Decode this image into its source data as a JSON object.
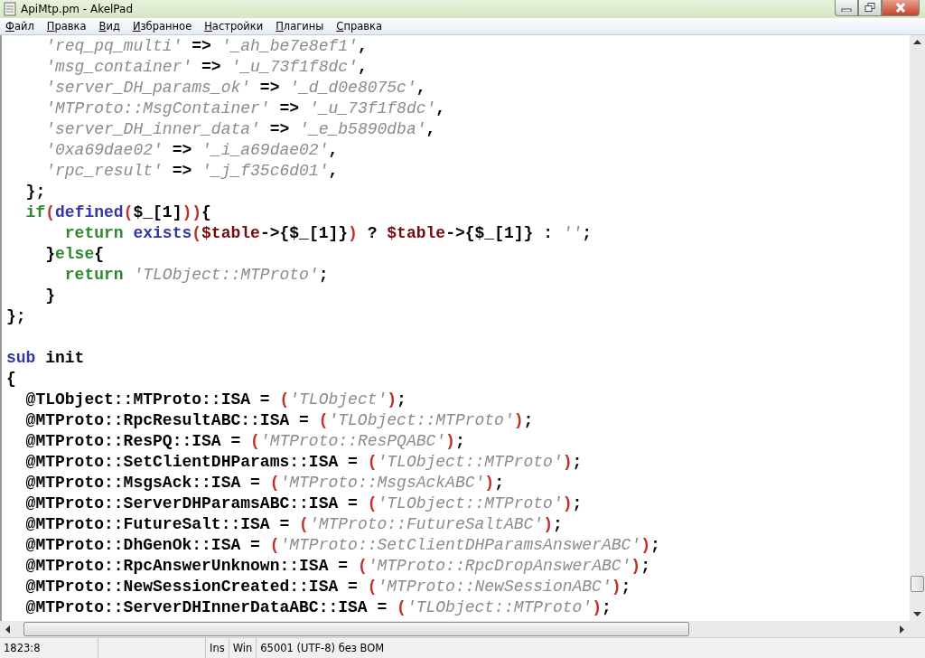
{
  "window": {
    "title": "ApiMtp.pm - AkelPad"
  },
  "menu": [
    "Файл",
    "Правка",
    "Вид",
    "Избранное",
    "Настройки",
    "Плагины",
    "Справка"
  ],
  "lines": [
    {
      "tokens": [
        {
          "kind": "str",
          "text": "    'req_pq_multi'"
        },
        {
          "kind": "id",
          "text": " => "
        },
        {
          "kind": "str",
          "text": "'_ah_be7e8ef1'"
        },
        {
          "kind": "id",
          "text": ","
        }
      ]
    },
    {
      "tokens": [
        {
          "kind": "str",
          "text": "    'msg_container'"
        },
        {
          "kind": "id",
          "text": " => "
        },
        {
          "kind": "str",
          "text": "'_u_73f1f8dc'"
        },
        {
          "kind": "id",
          "text": ","
        }
      ]
    },
    {
      "tokens": [
        {
          "kind": "str",
          "text": "    'server_DH_params_ok'"
        },
        {
          "kind": "id",
          "text": " => "
        },
        {
          "kind": "str",
          "text": "'_d_d0e8075c'"
        },
        {
          "kind": "id",
          "text": ","
        }
      ]
    },
    {
      "tokens": [
        {
          "kind": "str",
          "text": "    'MTProto::MsgContainer'"
        },
        {
          "kind": "id",
          "text": " => "
        },
        {
          "kind": "str",
          "text": "'_u_73f1f8dc'"
        },
        {
          "kind": "id",
          "text": ","
        }
      ]
    },
    {
      "tokens": [
        {
          "kind": "str",
          "text": "    'server_DH_inner_data'"
        },
        {
          "kind": "id",
          "text": " => "
        },
        {
          "kind": "str",
          "text": "'_e_b5890dba'"
        },
        {
          "kind": "id",
          "text": ","
        }
      ]
    },
    {
      "tokens": [
        {
          "kind": "str",
          "text": "    '0xa69dae02'"
        },
        {
          "kind": "id",
          "text": " => "
        },
        {
          "kind": "str",
          "text": "'_i_a69dae02'"
        },
        {
          "kind": "id",
          "text": ","
        }
      ]
    },
    {
      "tokens": [
        {
          "kind": "str",
          "text": "    'rpc_result'"
        },
        {
          "kind": "id",
          "text": " => "
        },
        {
          "kind": "str",
          "text": "'_j_f35c6d01'"
        },
        {
          "kind": "id",
          "text": ","
        }
      ]
    },
    {
      "tokens": [
        {
          "kind": "id",
          "text": "  };"
        }
      ]
    },
    {
      "tokens": [
        {
          "kind": "kw",
          "text": "  if"
        },
        {
          "kind": "paren",
          "text": "("
        },
        {
          "kind": "fn",
          "text": "defined"
        },
        {
          "kind": "paren",
          "text": "("
        },
        {
          "kind": "id",
          "text": "$_[1]"
        },
        {
          "kind": "paren",
          "text": "))"
        },
        {
          "kind": "id",
          "text": "{"
        }
      ]
    },
    {
      "tokens": [
        {
          "kind": "kw",
          "text": "      return "
        },
        {
          "kind": "fn",
          "text": "exists"
        },
        {
          "kind": "paren",
          "text": "("
        },
        {
          "kind": "var",
          "text": "$table"
        },
        {
          "kind": "id",
          "text": "->{$_[1]}"
        },
        {
          "kind": "paren",
          "text": ")"
        },
        {
          "kind": "id",
          "text": " ? "
        },
        {
          "kind": "var",
          "text": "$table"
        },
        {
          "kind": "id",
          "text": "->{$_[1]} : "
        },
        {
          "kind": "str",
          "text": "''"
        },
        {
          "kind": "id",
          "text": ";"
        }
      ]
    },
    {
      "tokens": [
        {
          "kind": "id",
          "text": "    }"
        },
        {
          "kind": "kw",
          "text": "else"
        },
        {
          "kind": "id",
          "text": "{"
        }
      ]
    },
    {
      "tokens": [
        {
          "kind": "kw",
          "text": "      return "
        },
        {
          "kind": "str",
          "text": "'TLObject::MTProto'"
        },
        {
          "kind": "id",
          "text": ";"
        }
      ]
    },
    {
      "tokens": [
        {
          "kind": "id",
          "text": "    }"
        }
      ]
    },
    {
      "tokens": [
        {
          "kind": "id",
          "text": "};"
        }
      ]
    },
    {
      "kind": "blank"
    },
    {
      "tokens": [
        {
          "kind": "fn",
          "text": "sub"
        },
        {
          "kind": "id",
          "text": " init"
        }
      ]
    },
    {
      "tokens": [
        {
          "kind": "id",
          "text": "{"
        }
      ]
    },
    {
      "tokens": [
        {
          "kind": "id",
          "text": "  @TLObject::MTProto::ISA = "
        },
        {
          "kind": "paren",
          "text": "("
        },
        {
          "kind": "str",
          "text": "'TLObject'"
        },
        {
          "kind": "paren",
          "text": ")"
        },
        {
          "kind": "id",
          "text": ";"
        }
      ]
    },
    {
      "tokens": [
        {
          "kind": "id",
          "text": "  @MTProto::RpcResultABC::ISA = "
        },
        {
          "kind": "paren",
          "text": "("
        },
        {
          "kind": "str",
          "text": "'TLObject::MTProto'"
        },
        {
          "kind": "paren",
          "text": ")"
        },
        {
          "kind": "id",
          "text": ";"
        }
      ]
    },
    {
      "tokens": [
        {
          "kind": "id",
          "text": "  @MTProto::ResPQ::ISA = "
        },
        {
          "kind": "paren",
          "text": "("
        },
        {
          "kind": "str",
          "text": "'MTProto::ResPQABC'"
        },
        {
          "kind": "paren",
          "text": ")"
        },
        {
          "kind": "id",
          "text": ";"
        }
      ]
    },
    {
      "tokens": [
        {
          "kind": "id",
          "text": "  @MTProto::SetClientDHParams::ISA = "
        },
        {
          "kind": "paren",
          "text": "("
        },
        {
          "kind": "str",
          "text": "'TLObject::MTProto'"
        },
        {
          "kind": "paren",
          "text": ")"
        },
        {
          "kind": "id",
          "text": ";"
        }
      ]
    },
    {
      "tokens": [
        {
          "kind": "id",
          "text": "  @MTProto::MsgsAck::ISA = "
        },
        {
          "kind": "paren",
          "text": "("
        },
        {
          "kind": "str",
          "text": "'MTProto::MsgsAckABC'"
        },
        {
          "kind": "paren",
          "text": ")"
        },
        {
          "kind": "id",
          "text": ";"
        }
      ]
    },
    {
      "tokens": [
        {
          "kind": "id",
          "text": "  @MTProto::ServerDHParamsABC::ISA = "
        },
        {
          "kind": "paren",
          "text": "("
        },
        {
          "kind": "str",
          "text": "'TLObject::MTProto'"
        },
        {
          "kind": "paren",
          "text": ")"
        },
        {
          "kind": "id",
          "text": ";"
        }
      ]
    },
    {
      "tokens": [
        {
          "kind": "id",
          "text": "  @MTProto::FutureSalt::ISA = "
        },
        {
          "kind": "paren",
          "text": "("
        },
        {
          "kind": "str",
          "text": "'MTProto::FutureSaltABC'"
        },
        {
          "kind": "paren",
          "text": ")"
        },
        {
          "kind": "id",
          "text": ";"
        }
      ]
    },
    {
      "tokens": [
        {
          "kind": "id",
          "text": "  @MTProto::DhGenOk::ISA = "
        },
        {
          "kind": "paren",
          "text": "("
        },
        {
          "kind": "str",
          "text": "'MTProto::SetClientDHParamsAnswerABC'"
        },
        {
          "kind": "paren",
          "text": ")"
        },
        {
          "kind": "id",
          "text": ";"
        }
      ]
    },
    {
      "tokens": [
        {
          "kind": "id",
          "text": "  @MTProto::RpcAnswerUnknown::ISA = "
        },
        {
          "kind": "paren",
          "text": "("
        },
        {
          "kind": "str",
          "text": "'MTProto::RpcDropAnswerABC'"
        },
        {
          "kind": "paren",
          "text": ")"
        },
        {
          "kind": "id",
          "text": ";"
        }
      ]
    },
    {
      "tokens": [
        {
          "kind": "id",
          "text": "  @MTProto::NewSessionCreated::ISA = "
        },
        {
          "kind": "paren",
          "text": "("
        },
        {
          "kind": "str",
          "text": "'MTProto::NewSessionABC'"
        },
        {
          "kind": "paren",
          "text": ")"
        },
        {
          "kind": "id",
          "text": ";"
        }
      ]
    },
    {
      "tokens": [
        {
          "kind": "id",
          "text": "  @MTProto::ServerDHInnerDataABC::ISA = "
        },
        {
          "kind": "paren",
          "text": "("
        },
        {
          "kind": "str",
          "text": "'TLObject::MTProto'"
        },
        {
          "kind": "paren",
          "text": ")"
        },
        {
          "kind": "id",
          "text": ";"
        }
      ]
    }
  ],
  "status_bar": {
    "position": "1823:8",
    "insert_mode": "Ins",
    "line_ending": "Win",
    "encoding": "65001 (UTF-8) без BOM"
  }
}
